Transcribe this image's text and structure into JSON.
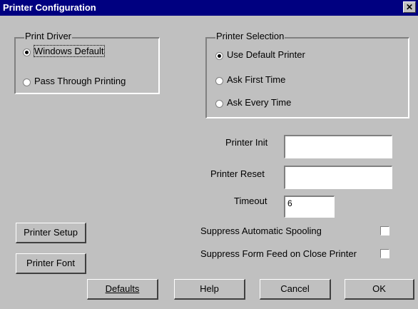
{
  "window": {
    "title": "Printer Configuration",
    "close_glyph": "✕"
  },
  "print_driver": {
    "legend": "Print Driver",
    "options": [
      {
        "label": "Windows Default",
        "selected": true
      },
      {
        "label": "Pass Through Printing",
        "selected": false
      }
    ]
  },
  "printer_selection": {
    "legend": "Printer Selection",
    "options": [
      {
        "label": "Use Default Printer",
        "selected": true
      },
      {
        "label": "Ask First Time",
        "selected": false
      },
      {
        "label": "Ask Every Time",
        "selected": false
      }
    ]
  },
  "fields": {
    "printer_init": {
      "label": "Printer Init",
      "value": ""
    },
    "printer_reset": {
      "label": "Printer Reset",
      "value": ""
    },
    "timeout": {
      "label": "Timeout",
      "value": "6"
    }
  },
  "options": {
    "suppress_spooling": {
      "label": "Suppress Automatic Spooling",
      "checked": false
    },
    "suppress_form_feed": {
      "label": "Suppress Form Feed on Close Printer",
      "checked": false
    }
  },
  "buttons": {
    "printer_setup": "Printer Setup",
    "printer_font": "Printer Font",
    "defaults": "Defaults",
    "help": "Help",
    "cancel": "Cancel",
    "ok": "OK"
  }
}
